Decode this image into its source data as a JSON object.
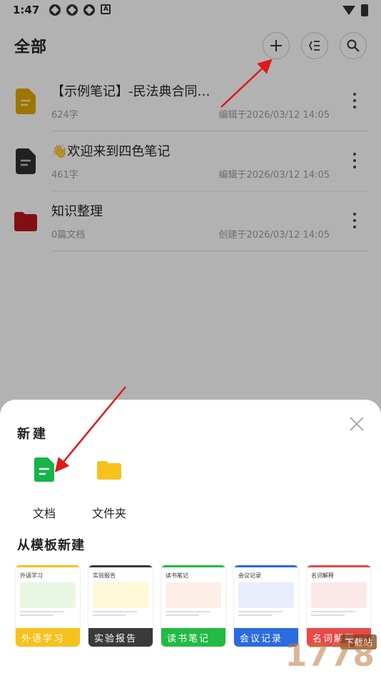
{
  "status_bar": {
    "time": "1:47",
    "badge": "A"
  },
  "header": {
    "title": "全部"
  },
  "files": [
    {
      "title": "【示例笔记】-民法典合同…",
      "size": "624字",
      "date": "编辑于2026/03/12 14:05",
      "icon": "doc-yellow-icon"
    },
    {
      "title": "👋欢迎来到四色笔记",
      "size": "461字",
      "date": "编辑于2026/03/12 14:05",
      "icon": "doc-dark-icon"
    },
    {
      "title": "知识整理",
      "size": "0篇文档",
      "date": "创建于2026/03/12 14:05",
      "icon": "folder-red-icon"
    }
  ],
  "sheet": {
    "title": "新建",
    "options": [
      {
        "label": "文档",
        "icon": "document-green-icon"
      },
      {
        "label": "文件夹",
        "icon": "folder-yellow-icon"
      }
    ],
    "templates_title": "从模板新建",
    "templates": [
      {
        "label": "外语学习",
        "head": "外语学习",
        "color": "#f6c21c"
      },
      {
        "label": "实验报告",
        "head": "实验报告",
        "color": "#3a3a3a"
      },
      {
        "label": "读书笔记",
        "head": "读书笔记",
        "color": "#22bb44"
      },
      {
        "label": "会议记录",
        "head": "会议记录",
        "color": "#2a6be0"
      },
      {
        "label": "名词解释",
        "head": "名词解释",
        "color": "#e84848"
      }
    ]
  },
  "watermark": {
    "text": "1778",
    "tag": "下载站"
  }
}
